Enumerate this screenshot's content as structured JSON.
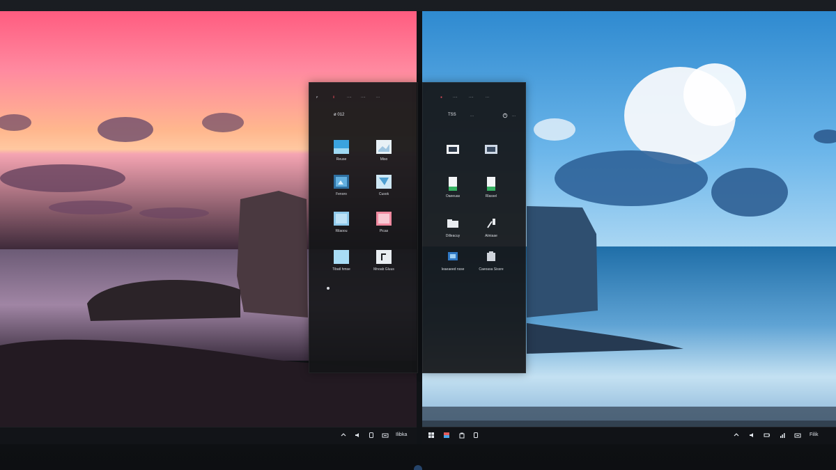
{
  "colors": {
    "accent_blue": "#3b82c4",
    "panel_bg": "#17181c",
    "taskbar_bg": "#121418"
  },
  "left_screen": {
    "panel": {
      "title": "ø 012",
      "menu": [
        "ꜰ",
        "Ⅱ",
        "····",
        "····",
        "···"
      ],
      "tiles": [
        {
          "icon": "image-file-icon",
          "label": "Reuse"
        },
        {
          "icon": "image-file-icon",
          "label": "Miso"
        },
        {
          "icon": "image-file-icon",
          "label": "Fenoro"
        },
        {
          "icon": "image-file-icon",
          "label": "Cusok"
        },
        {
          "icon": "image-file-icon",
          "label": "Rilaoou"
        },
        {
          "icon": "image-file-icon",
          "label": "Picas"
        },
        {
          "icon": "image-file-icon",
          "label": "Tibatl hmse"
        },
        {
          "icon": "image-file-icon",
          "label": "Mnoab Gluus"
        }
      ]
    },
    "taskbar": {
      "icons": [
        "chevron-up-icon",
        "speaker-icon",
        "tablet-icon",
        "keyboard-icon"
      ],
      "clock": "Ilibka"
    }
  },
  "right_screen": {
    "panel": {
      "title": "TSS",
      "menu": [
        "····",
        "····",
        "···",
        "···"
      ],
      "tiles": [
        {
          "icon": "monitor-icon",
          "label": ""
        },
        {
          "icon": "monitor-icon",
          "label": ""
        },
        {
          "icon": "document-icon",
          "label": "Oaeeuas"
        },
        {
          "icon": "document-icon",
          "label": "Rlassel"
        },
        {
          "icon": "folder-icon",
          "label": "Dilleacuy"
        },
        {
          "icon": "tools-icon",
          "label": "Aiiniaae"
        },
        {
          "icon": "app-icon",
          "label": "Ieaeaeed nsse"
        },
        {
          "icon": "app-icon",
          "label": "Caeoasa Sissre"
        }
      ]
    },
    "taskbar": {
      "icons": [
        "windows-start-icon",
        "gallery-icon",
        "store-icon",
        "tablet-icon",
        "chevron-up-icon",
        "speaker-icon",
        "battery-icon",
        "network-icon",
        "keyboard-icon"
      ],
      "clock": "Filik"
    }
  }
}
